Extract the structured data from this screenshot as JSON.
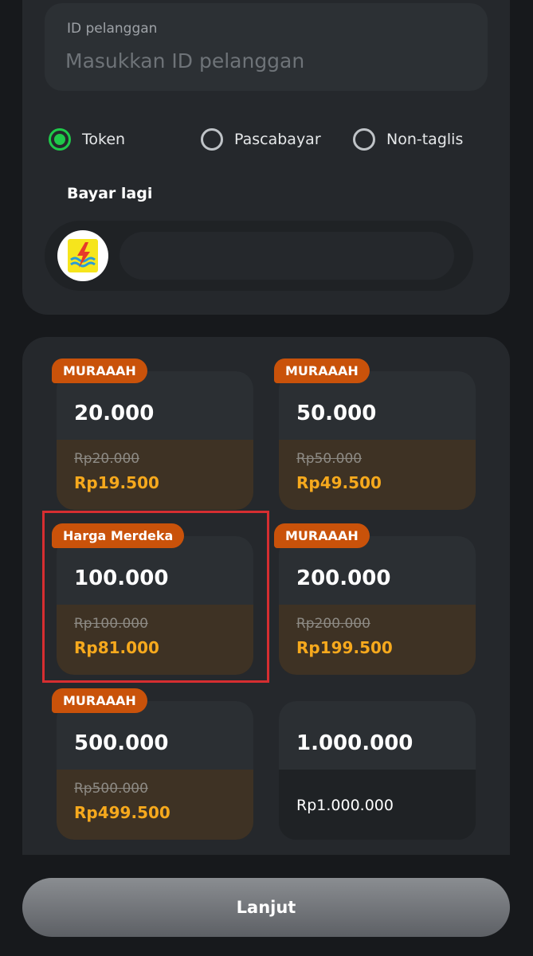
{
  "customer": {
    "label": "ID pelanggan",
    "placeholder": "Masukkan ID pelanggan",
    "value": ""
  },
  "payment_types": [
    {
      "label": "Token",
      "selected": true
    },
    {
      "label": "Pascabayar",
      "selected": false
    },
    {
      "label": "Non-taglis",
      "selected": false
    }
  ],
  "history": {
    "title": "Bayar lagi",
    "provider_icon": "pln-logo"
  },
  "products": [
    {
      "badge": "MURAAAH",
      "amount": "20.000",
      "old_price": "Rp20.000",
      "price": "Rp19.500"
    },
    {
      "badge": "MURAAAH",
      "amount": "50.000",
      "old_price": "Rp50.000",
      "price": "Rp49.500"
    },
    {
      "badge": "Harga Merdeka",
      "amount": "100.000",
      "old_price": "Rp100.000",
      "price": "Rp81.000",
      "highlighted": true
    },
    {
      "badge": "MURAAAH",
      "amount": "200.000",
      "old_price": "Rp200.000",
      "price": "Rp199.500"
    },
    {
      "badge": "MURAAAH",
      "amount": "500.000",
      "old_price": "Rp500.000",
      "price": "Rp499.500"
    },
    {
      "amount": "1.000.000",
      "price": "Rp1.000.000"
    }
  ],
  "cta": {
    "label": "Lanjut"
  },
  "colors": {
    "selected_radio": "#1fc94a",
    "badge": "#c9520a",
    "discount_price": "#f6a91d",
    "highlight_outline": "#d62e31"
  }
}
